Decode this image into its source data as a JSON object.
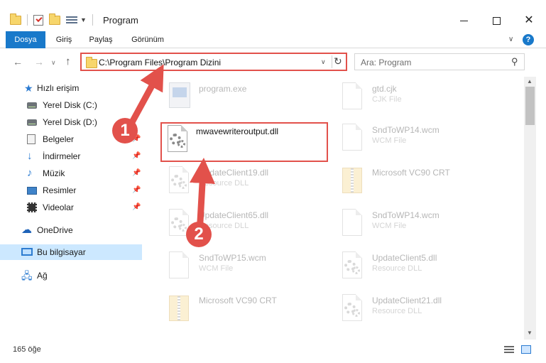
{
  "window": {
    "title": "Program",
    "colors": {
      "accent": "#1979ca",
      "callout": "#e2514b",
      "selection": "#cce8ff"
    }
  },
  "ribbon": {
    "tabs": [
      {
        "label": "Dosya",
        "active": true
      },
      {
        "label": "Giriş"
      },
      {
        "label": "Paylaş"
      },
      {
        "label": "Görünüm"
      }
    ],
    "help": "?"
  },
  "address": {
    "path": "C:\\Program Files\\Program Dizini"
  },
  "search": {
    "placeholder": "Ara: Program"
  },
  "sidebar": {
    "items": [
      {
        "label": "Hızlı erişim",
        "icon": "star-icon"
      },
      {
        "label": "Yerel Disk (C:)",
        "icon": "disk-icon"
      },
      {
        "label": "Yerel Disk (D:)",
        "icon": "disk-icon"
      },
      {
        "label": "Belgeler",
        "icon": "document-icon"
      },
      {
        "label": "İndirmeler",
        "icon": "download-icon"
      },
      {
        "label": "Müzik",
        "icon": "music-icon"
      },
      {
        "label": "Resimler",
        "icon": "pictures-icon"
      },
      {
        "label": "Videolar",
        "icon": "video-icon"
      },
      {
        "label": "OneDrive",
        "icon": "cloud-icon"
      },
      {
        "label": "Bu bilgisayar",
        "icon": "computer-icon",
        "selected": true
      },
      {
        "label": "Ağ",
        "icon": "network-icon"
      }
    ]
  },
  "files": {
    "left": [
      {
        "name": "program.exe",
        "type": "",
        "icon": "exe-icon"
      },
      {
        "name": "mwavewriteroutput.dll",
        "type": "",
        "icon": "dll-gear-icon",
        "highlighted": true
      },
      {
        "name": "UpdateClient19.dll",
        "type": "Resource DLL",
        "icon": "dll-gear-icon"
      },
      {
        "name": "UpdateClient65.dll",
        "type": "Resource DLL",
        "icon": "dll-gear-icon"
      },
      {
        "name": "SndToWP15.wcm",
        "type": "WCM File",
        "icon": "file-icon"
      },
      {
        "name": "Microsoft VC90 CRT",
        "type": "",
        "icon": "zip-folder-icon"
      }
    ],
    "right": [
      {
        "name": "gtd.cjk",
        "type": "CJK File",
        "icon": "file-icon"
      },
      {
        "name": "SndToWP14.wcm",
        "type": "WCM File",
        "icon": "file-icon"
      },
      {
        "name": "Microsoft VC90 CRT",
        "type": "",
        "icon": "zip-folder-icon"
      },
      {
        "name": "SndToWP14.wcm",
        "type": "WCM File",
        "icon": "file-icon"
      },
      {
        "name": "UpdateClient5.dll",
        "type": "Resource DLL",
        "icon": "dll-gear-icon"
      },
      {
        "name": "UpdateClient21.dll",
        "type": "Resource DLL",
        "icon": "dll-gear-icon"
      }
    ]
  },
  "status": {
    "count": "165 öğe"
  },
  "callouts": {
    "one": "1",
    "two": "2"
  }
}
